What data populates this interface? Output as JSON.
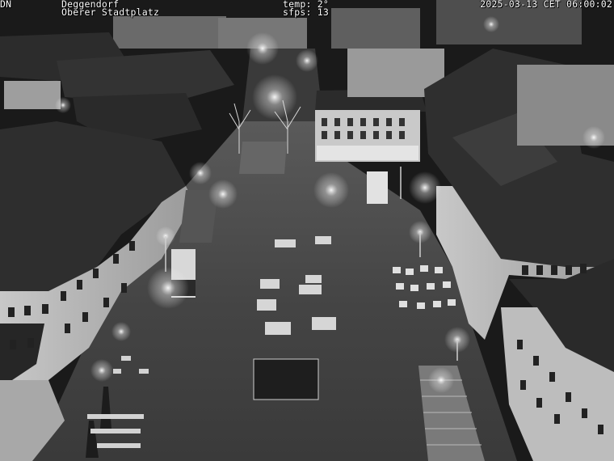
{
  "overlay": {
    "camera_tag": "DN",
    "city": "Deggendorf",
    "location": "Oberer Stadtplatz",
    "temperature": "temp: 2°",
    "frame_rate": "sfps: 13",
    "timestamp": "2025-03-13 CET 06:00:02"
  },
  "scene": {
    "palette": {
      "sky": "#141414",
      "roof_dark": "#2a2a2a",
      "roof_mid": "#3e3e3e",
      "facade": "#b9b9b9",
      "facade_dim": "#8a8a8a",
      "square": "#4a4a4a",
      "light_glow": "#ffffff"
    }
  }
}
